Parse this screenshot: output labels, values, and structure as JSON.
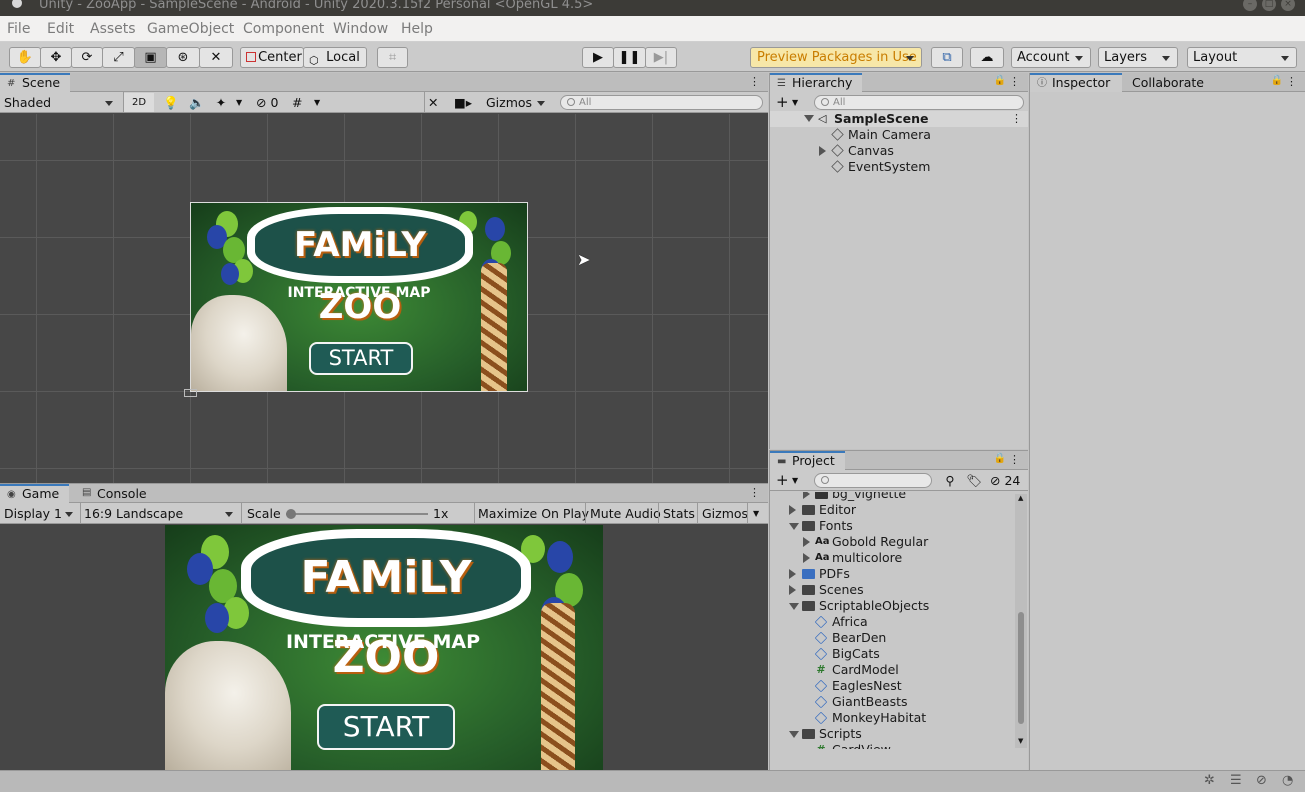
{
  "window": {
    "title": "Unity - ZooApp - SampleScene - Android - Unity 2020.3.15f2 Personal <OpenGL 4.5>"
  },
  "menu": [
    "File",
    "Edit",
    "Assets",
    "GameObject",
    "Component",
    "Window",
    "Help"
  ],
  "toolbar": {
    "pivot_label": "Center",
    "space_label": "Local",
    "preview_packages": "Preview Packages in Use",
    "account": "Account",
    "layers": "Layers",
    "layout": "Layout"
  },
  "scene": {
    "tab": "Scene",
    "shading": "Shaded",
    "mode_2d": "2D",
    "hidden_count": "0",
    "gizmos": "Gizmos",
    "search_placeholder": "All"
  },
  "game": {
    "tab": "Game",
    "console_tab": "Console",
    "display": "Display 1",
    "aspect": "16:9 Landscape",
    "scale_label": "Scale",
    "scale_value": "1x",
    "scale_fraction": 0,
    "maximize": "Maximize On Play",
    "mute": "Mute Audio",
    "stats": "Stats",
    "gizmos": "Gizmos"
  },
  "app_screen": {
    "logo": "FAMiLY ZOO",
    "subtitle": "INTERACTIVE MAP",
    "start": "START"
  },
  "hierarchy": {
    "tab": "Hierarchy",
    "search_placeholder": "All",
    "scene_name": "SampleScene",
    "items": [
      {
        "label": "Main Camera",
        "expandable": false
      },
      {
        "label": "Canvas",
        "expandable": true
      },
      {
        "label": "EventSystem",
        "expandable": false
      }
    ]
  },
  "inspector": {
    "tab": "Inspector",
    "collab_tab": "Collaborate"
  },
  "project": {
    "tab": "Project",
    "hidden_count": "24",
    "items": [
      {
        "label": "bg_vignette",
        "depth": 2,
        "kind": "texture",
        "arrow": "right"
      },
      {
        "label": "Editor",
        "depth": 1,
        "kind": "folder",
        "arrow": "right"
      },
      {
        "label": "Fonts",
        "depth": 1,
        "kind": "folder-open",
        "arrow": "down"
      },
      {
        "label": "Gobold Regular",
        "depth": 2,
        "kind": "font",
        "arrow": "right"
      },
      {
        "label": "multicolore",
        "depth": 2,
        "kind": "font",
        "arrow": "right"
      },
      {
        "label": "PDFs",
        "depth": 1,
        "kind": "folder-pdf",
        "arrow": "right"
      },
      {
        "label": "Scenes",
        "depth": 1,
        "kind": "folder",
        "arrow": "right"
      },
      {
        "label": "ScriptableObjects",
        "depth": 1,
        "kind": "folder-open",
        "arrow": "down"
      },
      {
        "label": "Africa",
        "depth": 2,
        "kind": "so",
        "arrow": "none"
      },
      {
        "label": "BearDen",
        "depth": 2,
        "kind": "so",
        "arrow": "none"
      },
      {
        "label": "BigCats",
        "depth": 2,
        "kind": "so",
        "arrow": "none"
      },
      {
        "label": "CardModel",
        "depth": 2,
        "kind": "script",
        "arrow": "none"
      },
      {
        "label": "EaglesNest",
        "depth": 2,
        "kind": "so",
        "arrow": "none"
      },
      {
        "label": "GiantBeasts",
        "depth": 2,
        "kind": "so",
        "arrow": "none"
      },
      {
        "label": "MonkeyHabitat",
        "depth": 2,
        "kind": "so",
        "arrow": "none"
      },
      {
        "label": "Scripts",
        "depth": 1,
        "kind": "folder-open",
        "arrow": "down"
      },
      {
        "label": "CardView",
        "depth": 2,
        "kind": "script",
        "arrow": "none"
      }
    ]
  },
  "icons": {
    "tools": [
      "hand-icon",
      "move-icon",
      "rotate-icon",
      "scale-icon",
      "rect-icon",
      "transform-icon",
      "custom-tool-icon"
    ],
    "play": "play-icon",
    "pause": "pause-icon",
    "step": "step-icon",
    "cloud": "cloud-icon",
    "collab": "collab-icon"
  },
  "colors": {
    "accent": "#3a79bb",
    "preview_packages_bg": "#f7e7a8",
    "preview_packages_text": "#c97d00",
    "scene_bg": "#474747",
    "game_green": "#2b6a2c",
    "logo_teal": "#1d5149"
  }
}
